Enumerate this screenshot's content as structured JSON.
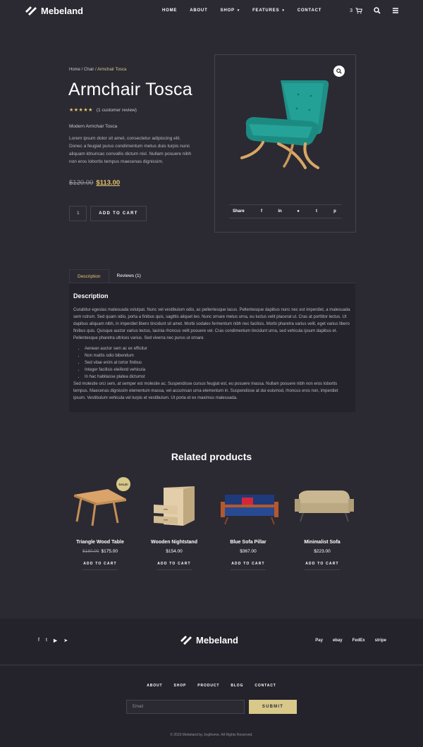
{
  "header": {
    "brand": "Mebeland",
    "nav": [
      "HOME",
      "ABOUT",
      "SHOP",
      "FEATURES",
      "CONTACT"
    ],
    "cart_count": "3"
  },
  "product": {
    "breadcrumb": {
      "home": "Home",
      "sep1": " / ",
      "category": "Chair",
      "sep2": " / ",
      "current": "Armchair Tosca"
    },
    "title": "Armchair Tosca",
    "stars": "★★★★★",
    "rating_text": "(1 customer review)",
    "subtitle": "Modern Armchair Tosca",
    "short_description": "Lorem ipsum dolor sit amet, consectetur adipiscing elit. Donec a feugiat purus condimentum metus duis turpis nunc aliquam ldnuncac convallis dictum nisl. Nullam posuere nibh non eros lobortis tempus maecenas dignissim.",
    "old_price": "$120.00",
    "new_price": "$113.00",
    "quantity": "1",
    "add_to_cart": "ADD TO CART",
    "share_label": "Share",
    "share_icons": [
      "facebook-icon",
      "linkedin-icon",
      "reddit-icon",
      "twitter-icon",
      "pinterest-icon"
    ]
  },
  "tabs": {
    "description_tab": "Description",
    "reviews_tab": "Reviews (1)",
    "heading": "Description",
    "para1": "Curabitur egestas malesuada volutpat. Nunc vel vestibulum odio, ac pellentesque lacus. Pellentesque dapibus nunc nec est imperdiet, a malesuada sem rutrum. Sed quam odio, porta a finibus quis, sagittis aliquet leo. Nunc ornare metus urna, eu luctus velit placerat ut. Cras at porttitor lectus. Ut dapibus aliquam nibh, in imperdiet libero tincidunt sit amet. Morbi sodales fermentum nibh nec facilisis. Morbi pharetra varius velit, eget varius libero finibus quis. Quisque auctor varius lectus, lacinia rhoncus velit posuere vel. Cras condimentum tincidunt urna, sed vehicula ipsum dapibus et. Pellentesque pharetra ultrices varius. Sed viverra nec purus ut ornare.",
    "bullets": [
      "Aenean auctor sem ac ex efficitur",
      "Non mattis odio bibendum",
      "Sed vitae enim at tortor finibus",
      "Integer facilisis eleifend vehicula",
      "In hac habitasse platea dictumst"
    ],
    "para2": "Sed molestie orci sem, at semper est molestie ac. Suspendisse cursus feugiat est, eu posuere massa. Nullam posuere nibh non eros lobortis tempus. Maecenas dignissim elementum massa, vel accumsan urna elementum in. Suspendisse at dui euismod, rhoncus eros non, imperdiet ipsum. Vestibulum vehicula vel turpis et vestibulum. Ut porta et ex maximus malesuada."
  },
  "related": {
    "title": "Related products",
    "sale_badge": "SALE!",
    "items": [
      {
        "name": "Triangle Wood Table",
        "old_price": "$180.00",
        "price": "$175.00",
        "button": "ADD TO CART"
      },
      {
        "name": "Wooden Nightstand",
        "old_price": "",
        "price": "$154.00",
        "button": "ADD TO CART"
      },
      {
        "name": "Blue Sofa Pillar",
        "old_price": "",
        "price": "$367.00",
        "button": "ADD TO CART"
      },
      {
        "name": "Minimalist Sofa",
        "old_price": "",
        "price": "$223.00",
        "button": "ADD TO CART"
      }
    ]
  },
  "footer": {
    "brand": "Mebeland",
    "payments": [
      "Pay",
      "ebay",
      "FedEx",
      "stripe"
    ],
    "nav": [
      "ABOUT",
      "SHOP",
      "PRODUCT",
      "BLOG",
      "CONTACT"
    ],
    "email_placeholder": "Email",
    "submit": "SUBMIT",
    "copyright": "© 2023 Mebeland by Jegtheme. All Rights Reserved."
  },
  "colors": {
    "background": "#2b2a33",
    "panel": "#24232b",
    "accent": "#e6c66e",
    "button": "#d8c98a"
  }
}
